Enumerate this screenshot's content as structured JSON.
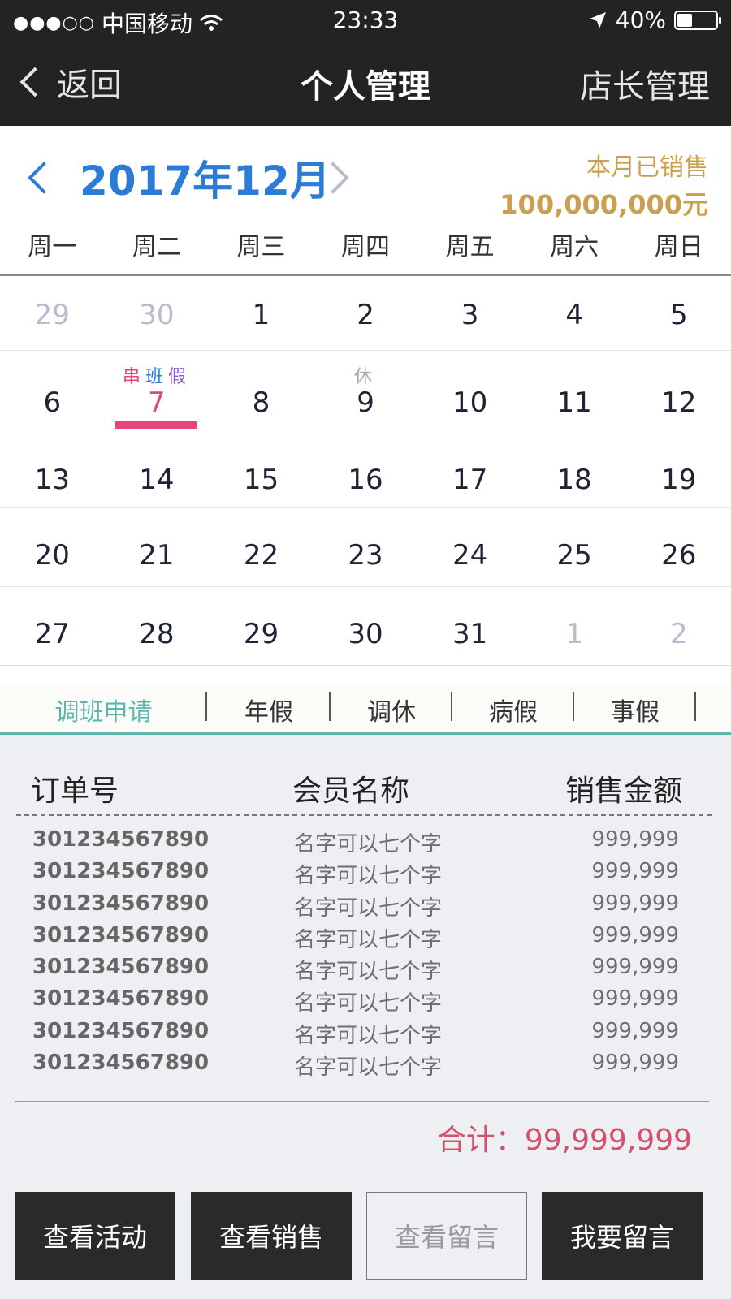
{
  "status_bar": {
    "signal": "●●●○○",
    "carrier": "中国移动",
    "time": "23:33",
    "battery_text": "40%",
    "battery_level": 0.4
  },
  "nav": {
    "back_label": "返回",
    "title": "个人管理",
    "right_label": "店长管理"
  },
  "month_header": {
    "month_label": "2017年12月",
    "sold_label": "本月已销售",
    "sold_value": "100,000,000元"
  },
  "calendar": {
    "weekdays": [
      "周一",
      "周二",
      "周三",
      "周四",
      "周五",
      "周六",
      "周日"
    ],
    "rows": [
      [
        {
          "d": "29",
          "muted": true
        },
        {
          "d": "30",
          "muted": true
        },
        {
          "d": "1"
        },
        {
          "d": "2"
        },
        {
          "d": "3"
        },
        {
          "d": "4"
        },
        {
          "d": "5"
        }
      ],
      [
        {
          "d": "6"
        },
        {
          "d": "7",
          "today": true,
          "tags": [
            [
              "串",
              "tag-chuan"
            ],
            [
              "班",
              "tag-ban"
            ],
            [
              "假",
              "tag-jia"
            ]
          ]
        },
        {
          "d": "8"
        },
        {
          "d": "9",
          "tags": [
            [
              "休",
              "tag-xiu"
            ]
          ]
        },
        {
          "d": "10"
        },
        {
          "d": "11"
        },
        {
          "d": "12"
        }
      ],
      [
        {
          "d": "13"
        },
        {
          "d": "14"
        },
        {
          "d": "15"
        },
        {
          "d": "16"
        },
        {
          "d": "17"
        },
        {
          "d": "18"
        },
        {
          "d": "19"
        }
      ],
      [
        {
          "d": "20"
        },
        {
          "d": "21"
        },
        {
          "d": "22"
        },
        {
          "d": "23"
        },
        {
          "d": "24"
        },
        {
          "d": "25"
        },
        {
          "d": "26"
        }
      ],
      [
        {
          "d": "27"
        },
        {
          "d": "28"
        },
        {
          "d": "29"
        },
        {
          "d": "30"
        },
        {
          "d": "31"
        },
        {
          "d": "1",
          "muted": true
        },
        {
          "d": "2",
          "muted": true
        }
      ]
    ]
  },
  "tabs": [
    "调班申请",
    "年假",
    "调休",
    "病假",
    "事假"
  ],
  "orders": {
    "headers": {
      "order": "订单号",
      "member": "会员名称",
      "amount": "销售金额"
    },
    "rows": [
      {
        "order": "301234567890",
        "member": "名字可以七个字",
        "amount": "999,999"
      },
      {
        "order": "301234567890",
        "member": "名字可以七个字",
        "amount": "999,999"
      },
      {
        "order": "301234567890",
        "member": "名字可以七个字",
        "amount": "999,999"
      },
      {
        "order": "301234567890",
        "member": "名字可以七个字",
        "amount": "999,999"
      },
      {
        "order": "301234567890",
        "member": "名字可以七个字",
        "amount": "999,999"
      },
      {
        "order": "301234567890",
        "member": "名字可以七个字",
        "amount": "999,999"
      },
      {
        "order": "301234567890",
        "member": "名字可以七个字",
        "amount": "999,999"
      },
      {
        "order": "301234567890",
        "member": "名字可以七个字",
        "amount": "999,999"
      }
    ],
    "total": "合计：99,999,999"
  },
  "buttons": [
    {
      "label": "查看活动",
      "style": "solid"
    },
    {
      "label": "查看销售",
      "style": "solid"
    },
    {
      "label": "查看留言",
      "style": "ghost"
    },
    {
      "label": "我要留言",
      "style": "solid"
    }
  ],
  "colors": {
    "accent_blue": "#2c7bd6",
    "gold": "#c9a04f",
    "pink": "#e6467a",
    "teal": "#5fb4ad",
    "total_red": "#d4506b"
  }
}
